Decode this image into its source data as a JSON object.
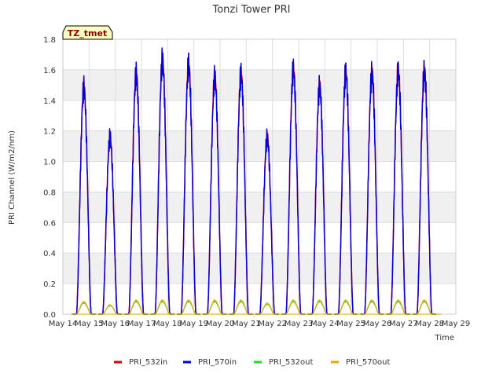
{
  "chart_data": {
    "type": "line",
    "title": "Tonzi Tower PRI",
    "xlabel": "Time",
    "ylabel": "PRI Channel (W/m2/nm)",
    "badge": "TZ_tmet",
    "xlim": [
      14,
      29
    ],
    "ylim": [
      0,
      1.8
    ],
    "x_ticks": [
      {
        "v": 14,
        "label": "May 14"
      },
      {
        "v": 15,
        "label": "May 15"
      },
      {
        "v": 16,
        "label": "May 16"
      },
      {
        "v": 17,
        "label": "May 17"
      },
      {
        "v": 18,
        "label": "May 18"
      },
      {
        "v": 19,
        "label": "May 19"
      },
      {
        "v": 20,
        "label": "May 20"
      },
      {
        "v": 21,
        "label": "May 21"
      },
      {
        "v": 22,
        "label": "May 22"
      },
      {
        "v": 23,
        "label": "May 23"
      },
      {
        "v": 24,
        "label": "May 24"
      },
      {
        "v": 25,
        "label": "May 25"
      },
      {
        "v": 26,
        "label": "May 26"
      },
      {
        "v": 27,
        "label": "May 27"
      },
      {
        "v": 28,
        "label": "May 28"
      },
      {
        "v": 29,
        "label": "May 29"
      }
    ],
    "y_ticks": [
      {
        "v": 0.0,
        "label": "0.0"
      },
      {
        "v": 0.2,
        "label": "0.2"
      },
      {
        "v": 0.4,
        "label": "0.4"
      },
      {
        "v": 0.6,
        "label": "0.6"
      },
      {
        "v": 0.8,
        "label": "0.8"
      },
      {
        "v": 1.0,
        "label": "1.0"
      },
      {
        "v": 1.2,
        "label": "1.2"
      },
      {
        "v": 1.4,
        "label": "1.4"
      },
      {
        "v": 1.6,
        "label": "1.6"
      },
      {
        "v": 1.8,
        "label": "1.8"
      }
    ],
    "grid": true,
    "legend_position": "bottom",
    "series": [
      {
        "name": "PRI_532in",
        "color": "#dd0000"
      },
      {
        "name": "PRI_570in",
        "color": "#0000dd"
      },
      {
        "name": "PRI_532out",
        "color": "#22dd22"
      },
      {
        "name": "PRI_570out",
        "color": "#ddaa00"
      }
    ],
    "daily_peaks": [
      {
        "day": "May 14",
        "center": 14.8,
        "in_peak": 1.5,
        "out_peak": 0.08
      },
      {
        "day": "May 15",
        "center": 15.8,
        "in_peak": 1.17,
        "out_peak": 0.06
      },
      {
        "day": "May 16",
        "center": 16.8,
        "in_peak": 1.59,
        "out_peak": 0.09
      },
      {
        "day": "May 17",
        "center": 17.8,
        "in_peak": 1.68,
        "out_peak": 0.09
      },
      {
        "day": "May 18",
        "center": 18.8,
        "in_peak": 1.65,
        "out_peak": 0.09
      },
      {
        "day": "May 19",
        "center": 19.8,
        "in_peak": 1.57,
        "out_peak": 0.09
      },
      {
        "day": "May 20",
        "center": 20.8,
        "in_peak": 1.59,
        "out_peak": 0.09
      },
      {
        "day": "May 21",
        "center": 21.8,
        "in_peak": 1.17,
        "out_peak": 0.07
      },
      {
        "day": "May 22",
        "center": 22.8,
        "in_peak": 1.62,
        "out_peak": 0.09
      },
      {
        "day": "May 23",
        "center": 23.8,
        "in_peak": 1.51,
        "out_peak": 0.09
      },
      {
        "day": "May 24",
        "center": 24.8,
        "in_peak": 1.6,
        "out_peak": 0.09
      },
      {
        "day": "May 25",
        "center": 25.8,
        "in_peak": 1.6,
        "out_peak": 0.09
      },
      {
        "day": "May 26",
        "center": 26.8,
        "in_peak": 1.61,
        "out_peak": 0.09
      },
      {
        "day": "May 27",
        "center": 27.8,
        "in_peak": 1.61,
        "out_peak": 0.09
      }
    ]
  }
}
